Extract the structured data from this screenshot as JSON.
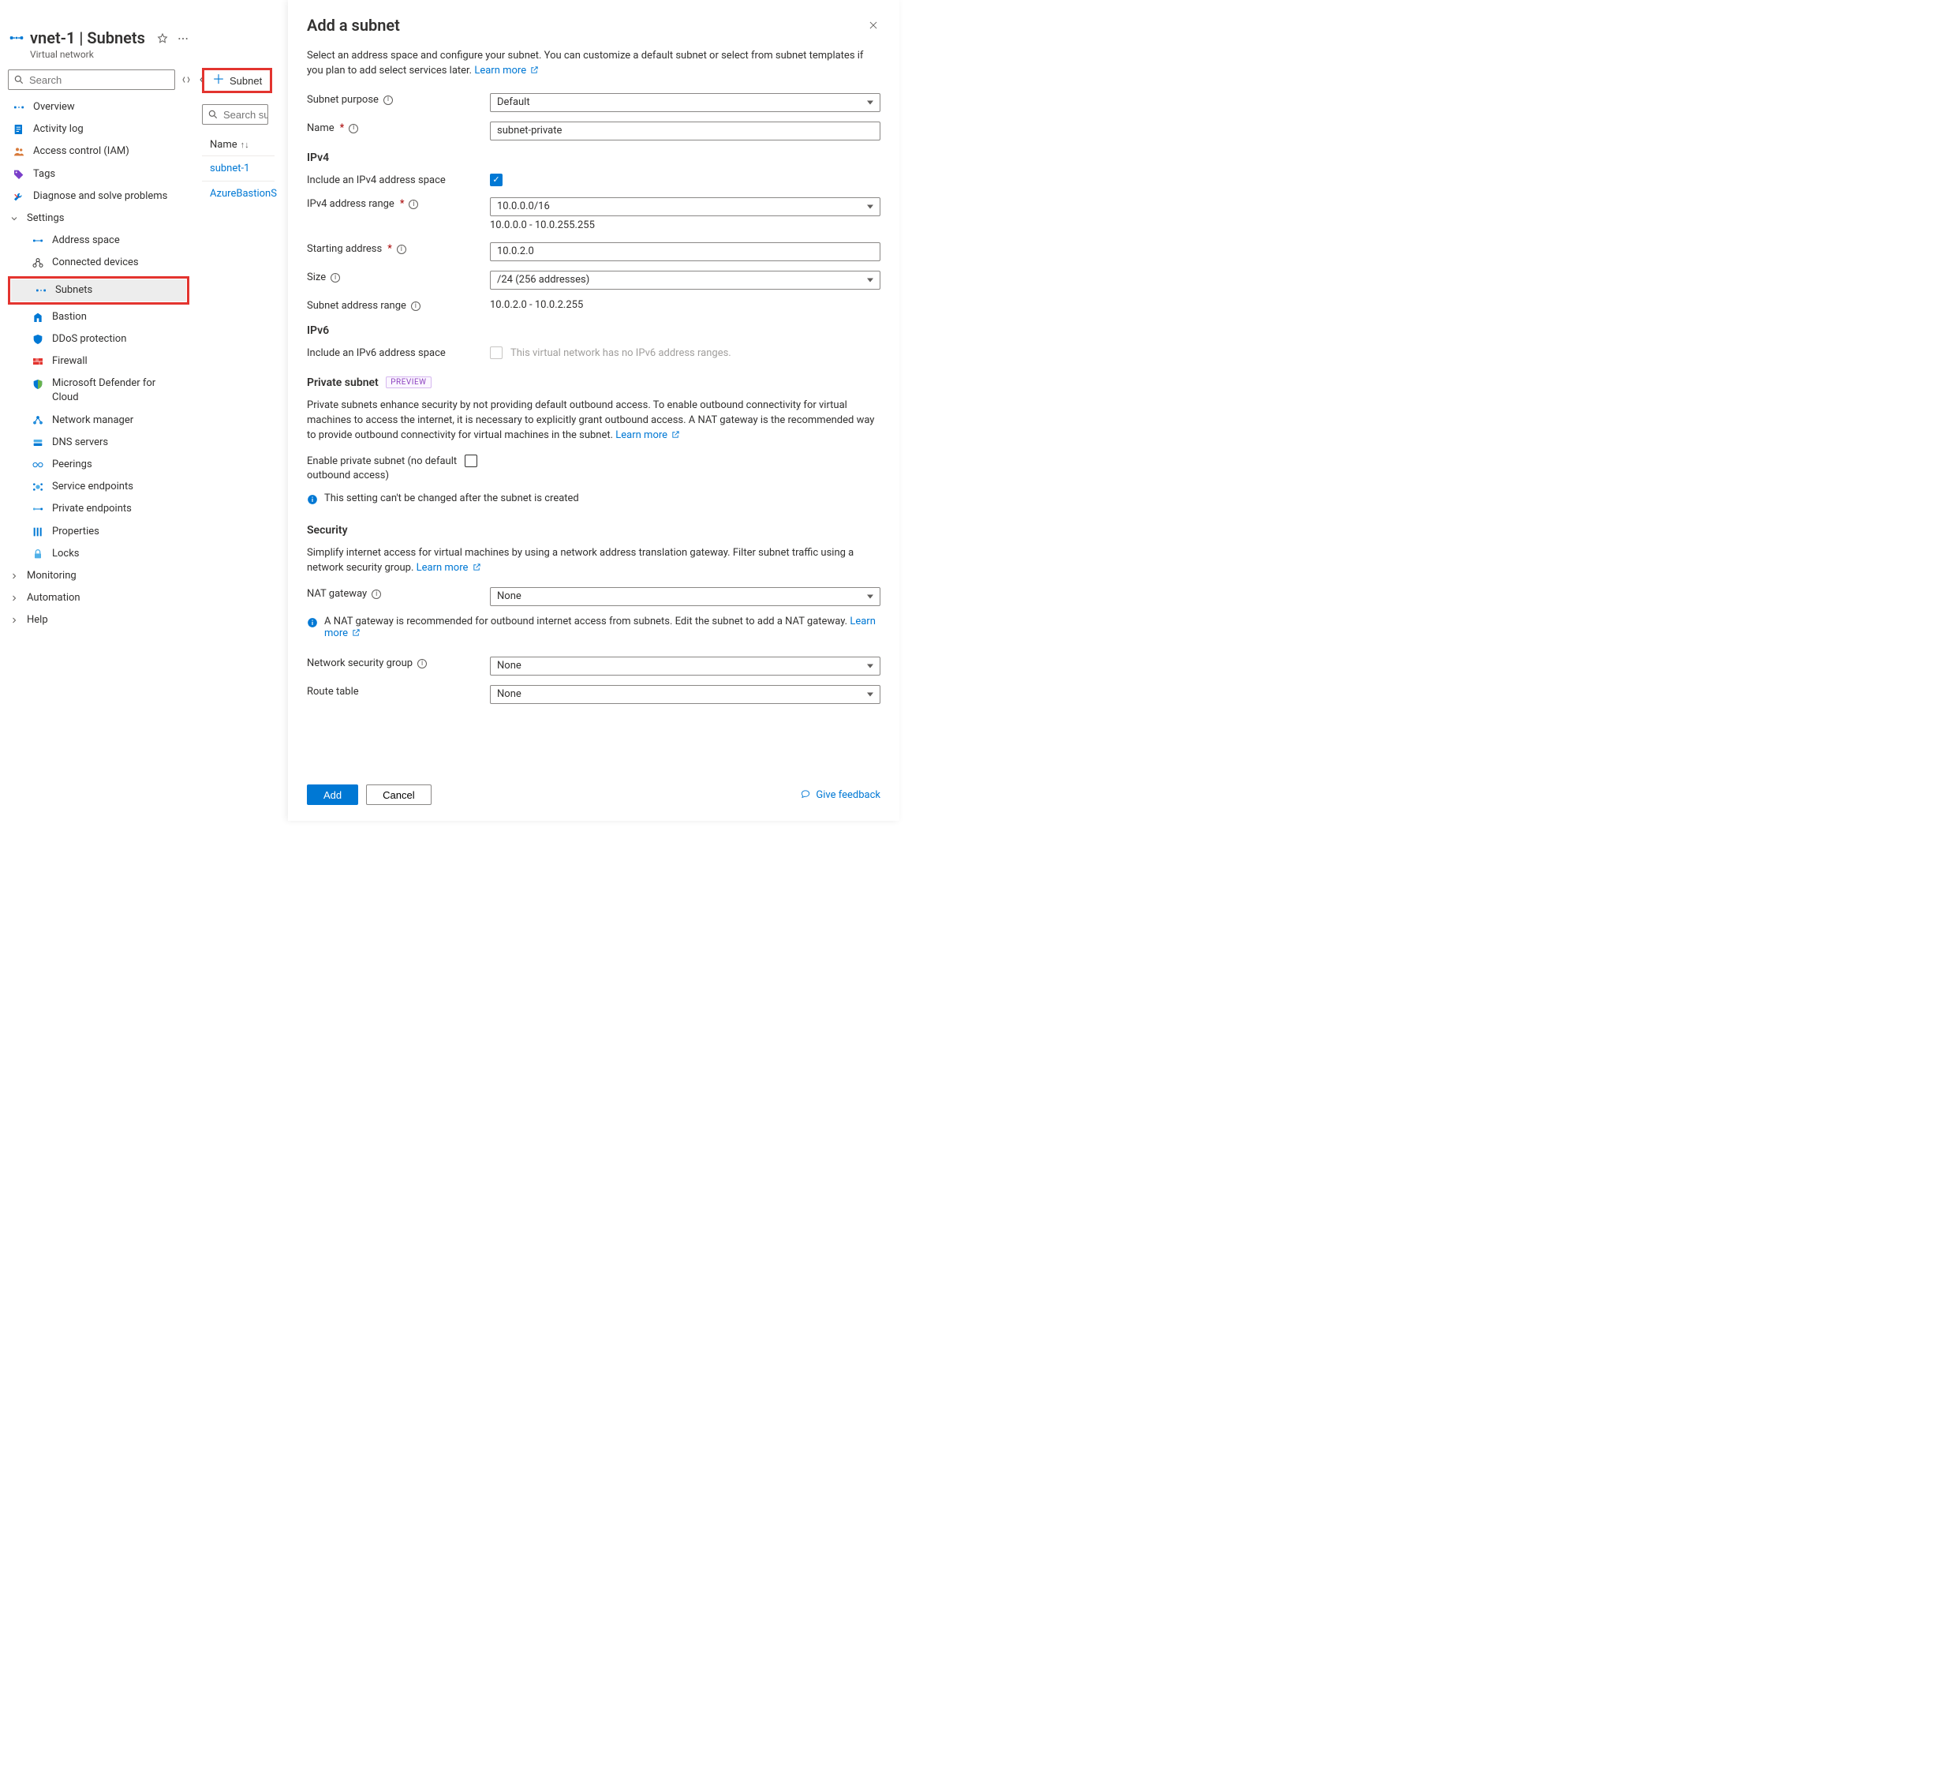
{
  "header": {
    "title": "vnet-1 | Subnets",
    "subtitle": "Virtual network"
  },
  "nav": {
    "search_placeholder": "Search",
    "items": {
      "overview": "Overview",
      "activity": "Activity log",
      "iam": "Access control (IAM)",
      "tags": "Tags",
      "diagnose": "Diagnose and solve problems",
      "settings": "Settings",
      "address": "Address space",
      "devices": "Connected devices",
      "subnets": "Subnets",
      "bastion": "Bastion",
      "ddos": "DDoS protection",
      "firewall": "Firewall",
      "defender": "Microsoft Defender for Cloud",
      "netmgr": "Network manager",
      "dns": "DNS servers",
      "peerings": "Peerings",
      "svcend": "Service endpoints",
      "privend": "Private endpoints",
      "props": "Properties",
      "locks": "Locks",
      "monitoring": "Monitoring",
      "automation": "Automation",
      "help": "Help"
    }
  },
  "mid": {
    "subnet_btn": "Subnet",
    "search_placeholder": "Search subn",
    "col_name": "Name",
    "rows": [
      "subnet-1",
      "AzureBastionS"
    ]
  },
  "panel": {
    "title": "Add a subnet",
    "intro": "Select an address space and configure your subnet. You can customize a default subnet or select from subnet templates if you plan to add select services later.  ",
    "learn_more": "Learn more",
    "purpose_label": "Subnet purpose",
    "purpose_value": "Default",
    "name_label": "Name",
    "name_value": "subnet-private",
    "ipv4_title": "IPv4",
    "inc_ipv4_label": "Include an IPv4 address space",
    "ipv4_range_label": "IPv4 address range",
    "ipv4_range_value": "10.0.0.0/16",
    "ipv4_range_hint": "10.0.0.0 - 10.0.255.255",
    "start_label": "Starting address",
    "start_value": "10.0.2.0",
    "size_label": "Size",
    "size_value": "/24 (256 addresses)",
    "subnet_range_label": "Subnet address range",
    "subnet_range_value": "10.0.2.0 - 10.0.2.255",
    "ipv6_title": "IPv6",
    "inc_ipv6_label": "Include an IPv6 address space",
    "ipv6_disabled_hint": "This virtual network has no IPv6 address ranges.",
    "private_title": "Private subnet",
    "preview_pill": "PREVIEW",
    "private_para": "Private subnets enhance security by not providing default outbound access. To enable outbound connectivity for virtual machines to access the internet, it is necessary to explicitly grant outbound access. A NAT gateway is the recommended way to provide outbound connectivity for virtual machines in the subnet.  ",
    "enable_private_label": "Enable private subnet (no default outbound access)",
    "private_info": "This setting can't be changed after the subnet is created",
    "security_title": "Security",
    "security_para": "Simplify internet access for virtual machines by using a network address translation gateway. Filter subnet traffic using a network security group.  ",
    "nat_label": "NAT gateway",
    "nat_value": "None",
    "nat_info": "A NAT gateway is recommended for outbound internet access from subnets. Edit the subnet to add a NAT gateway.  ",
    "nsg_label": "Network security group",
    "nsg_value": "None",
    "rt_label": "Route table",
    "rt_value": "None",
    "add_btn": "Add",
    "cancel_btn": "Cancel",
    "feedback": "Give feedback"
  }
}
